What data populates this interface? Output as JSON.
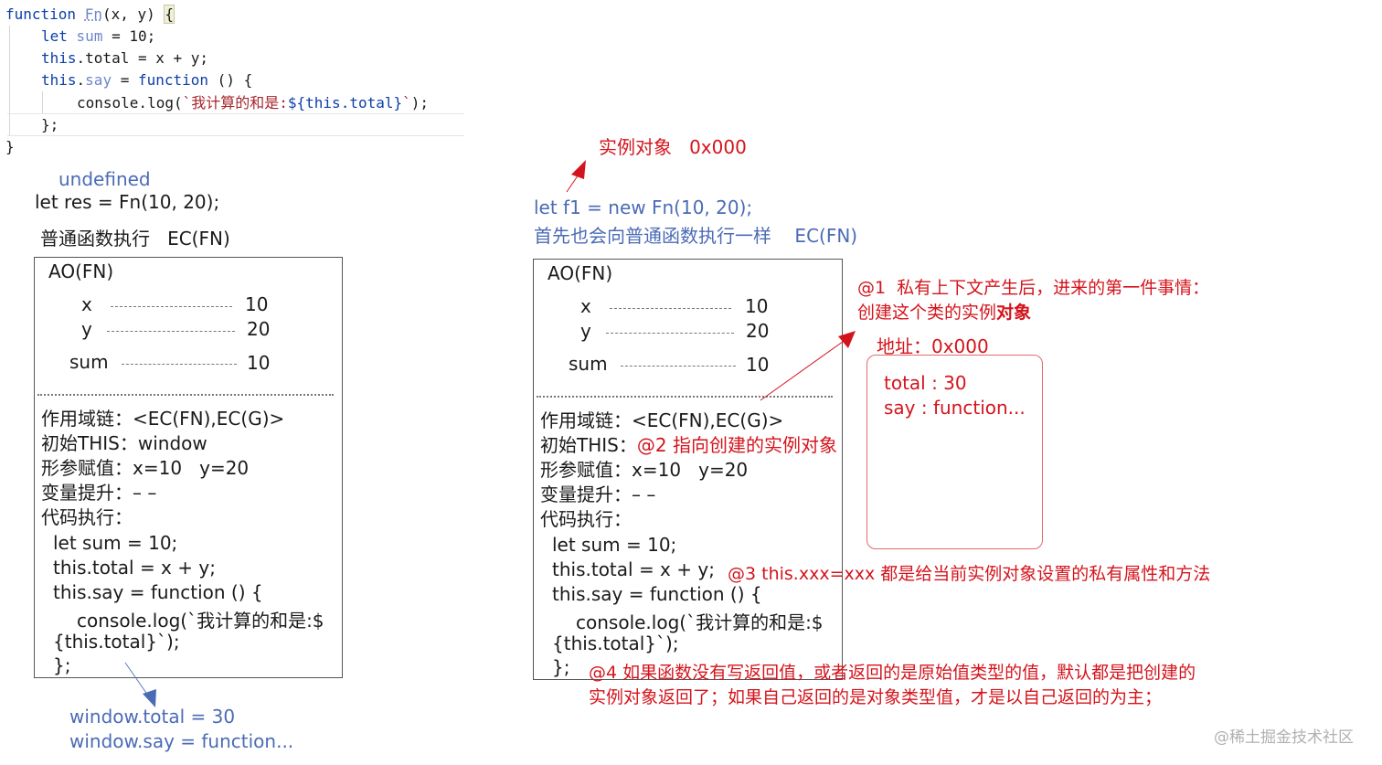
{
  "code": {
    "l1": {
      "kw": "function",
      "name": "Fn",
      "rest": "(x, y) ",
      "brace": "{"
    },
    "l2": {
      "kw": "let",
      "name": "sum",
      "rest": " = 10;"
    },
    "l3": {
      "kw": "this",
      "rest": ".total = x + y;"
    },
    "l4": {
      "kw": "this",
      "dot": ".",
      "name": "say",
      "eq": " = ",
      "kw2": "function",
      "rest": " () {"
    },
    "l5": {
      "pre": "console.",
      "fn": "log",
      "paren": "(",
      "str": "`我计算的和是:",
      "tpl1": "${",
      "kw": "this",
      "tpl2": ".total}",
      "str2": "`",
      "end": ");"
    },
    "l6": "};",
    "l7": "}"
  },
  "left": {
    "undefined_label": "undefined",
    "call": "let res = Fn(10, 20);",
    "ec_label": "普通函数执行   EC(FN)",
    "ao_title": "AO(FN)",
    "vars": [
      {
        "name": "x",
        "value": "10"
      },
      {
        "name": "y",
        "value": "20"
      },
      {
        "name": "sum",
        "value": "10"
      }
    ],
    "scope": "作用域链：<EC(FN),EC(G)>",
    "this_init": "初始THIS：window",
    "params": "形参赋值：x=10   y=20",
    "hoist": "变量提升：– –",
    "exec": "代码执行：",
    "code_lines": [
      "let sum = 10;",
      "this.total = x + y;",
      "this.say = function () {",
      "console.log(`我计算的和是:$",
      "{this.total}`);",
      "};"
    ],
    "result1": "window.total = 30",
    "result2": "window.say = function..."
  },
  "right": {
    "instance_label": "实例对象   0x000",
    "call": "let f1 = new Fn(10, 20);",
    "note": "首先也会向普通函数执行一样    EC(FN)",
    "ao_title": "AO(FN)",
    "vars": [
      {
        "name": "x",
        "value": "10"
      },
      {
        "name": "y",
        "value": "20"
      },
      {
        "name": "sum",
        "value": "10"
      }
    ],
    "scope": "作用域链：<EC(FN),EC(G)>",
    "this_init_prefix": "初始THIS：",
    "this_init_note": "@2 指向创建的实例对象",
    "params": "形参赋值：x=10   y=20",
    "hoist": "变量提升：– –",
    "exec": "代码执行：",
    "code_lines": [
      "let sum = 10;",
      "this.total = x + y;",
      "this.say = function () {",
      "console.log(`我计算的和是:$",
      "{this.total}`);",
      "};"
    ],
    "note1_line1": "@1  私有上下文产生后，进来的第一件事情：",
    "note1_line2_a": "创建这个类的实例",
    "note1_line2_b": "对象",
    "address": "地址：0x000",
    "obj_total": "total : 30",
    "obj_say": "say : function...",
    "note3": "@3 this.xxx=xxx 都是给当前实例对象设置的私有属性和方法",
    "note4_line1": "@4 如果函数没有写返回值，或者返回的是原始值类型的值，默认都是把创建的",
    "note4_line2": "实例对象返回了；如果自己返回的是对象类型值，才是以自己返回的为主；"
  },
  "watermark": "@稀土掘金技术社区",
  "colors": {
    "code_keyword": "#0b3fa8",
    "code_var": "#6f87c7",
    "code_string": "#a6262c",
    "note_blue": "#4b6bb5",
    "note_red": "#d4141c"
  }
}
